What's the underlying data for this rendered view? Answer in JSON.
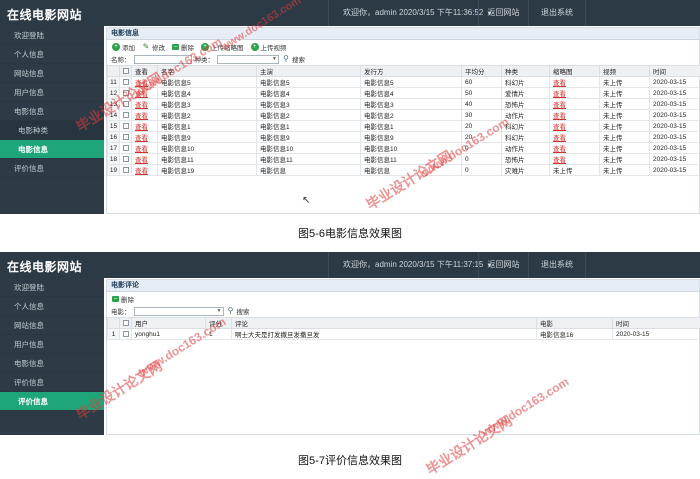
{
  "shot1": {
    "brand": "在线电影网站",
    "userinfo": "欢迎你，admin  2020/3/15 下午11:36:52",
    "top_links": [
      "返回网站",
      "退出系统"
    ],
    "sidebar": [
      "欢迎登陆",
      "个人信息",
      "网站信息",
      "用户信息",
      "电影信息",
      "电影种类",
      "电影信息",
      "评价信息"
    ],
    "panel_title": "电影信息",
    "toolbar": [
      "添加",
      "修改",
      "删除",
      "上传缩略图",
      "上传视频"
    ],
    "search": {
      "label1": "名称：",
      "label2": "种类：",
      "button": "搜索"
    },
    "columns": [
      "查看",
      "名字",
      "主演",
      "发行方",
      "平均分",
      "种类",
      "缩略图",
      "视频",
      "时间"
    ],
    "rows": [
      [
        "11",
        "查看",
        "电影信息5",
        "电影信息5",
        "电影信息5",
        "60",
        "科幻片",
        "查看",
        "未上传",
        "2020-03-15"
      ],
      [
        "12",
        "查看",
        "电影信息4",
        "电影信息4",
        "电影信息4",
        "50",
        "爱情片",
        "查看",
        "未上传",
        "2020-03-15"
      ],
      [
        "13",
        "查看",
        "电影信息3",
        "电影信息3",
        "电影信息3",
        "40",
        "恐怖片",
        "查看",
        "未上传",
        "2020-03-15"
      ],
      [
        "14",
        "查看",
        "电影信息2",
        "电影信息2",
        "电影信息2",
        "30",
        "动作片",
        "查看",
        "未上传",
        "2020-03-15"
      ],
      [
        "15",
        "查看",
        "电影信息1",
        "电影信息1",
        "电影信息1",
        "20",
        "科幻片",
        "查看",
        "未上传",
        "2020-03-15"
      ],
      [
        "16",
        "查看",
        "电影信息9",
        "电影信息9",
        "电影信息9",
        "20",
        "科幻片",
        "查看",
        "未上传",
        "2020-03-15"
      ],
      [
        "17",
        "查看",
        "电影信息10",
        "电影信息10",
        "电影信息10",
        "0",
        "动作片",
        "查看",
        "未上传",
        "2020-03-15"
      ],
      [
        "18",
        "查看",
        "电影信息11",
        "电影信息11",
        "电影信息11",
        "0",
        "恐怖片",
        "查看",
        "未上传",
        "2020-03-15"
      ],
      [
        "19",
        "查看",
        "电影信息19",
        "电影信息",
        "电影信息",
        "0",
        "灾难片",
        "未上传",
        "未上传",
        "2020-03-15"
      ]
    ],
    "caption": "图5-6电影信息效果图"
  },
  "shot2": {
    "brand": "在线电影网站",
    "userinfo": "欢迎你，admin  2020/3/15 下午11:37:15",
    "top_links": [
      "返回网站",
      "退出系统"
    ],
    "sidebar": [
      "欢迎登陆",
      "个人信息",
      "网站信息",
      "用户信息",
      "电影信息",
      "评价信息",
      "评价信息"
    ],
    "panel_title": "电影评论",
    "toolbar": [
      "删除"
    ],
    "search": {
      "label1": "电影：",
      "button": "搜索"
    },
    "columns": [
      "用户",
      "评分",
      "评论",
      "电影",
      "时间"
    ],
    "rows": [
      [
        "1",
        "yonghu1",
        "1",
        "啊士大夫是打发撒旦发撒旦发",
        "电影信息16",
        "2020-03-15"
      ]
    ],
    "caption": "图5-7评价信息效果图"
  },
  "watermarks": {
    "text_cn": "毕业设计论文网",
    "text_url": "www.doc163.com"
  },
  "colors": {
    "topbar": "#2c3a45",
    "sidebar": "#2e3b46",
    "active": "#1fa57a",
    "link": "#d0312d",
    "watermark": "#dc3c3c"
  }
}
